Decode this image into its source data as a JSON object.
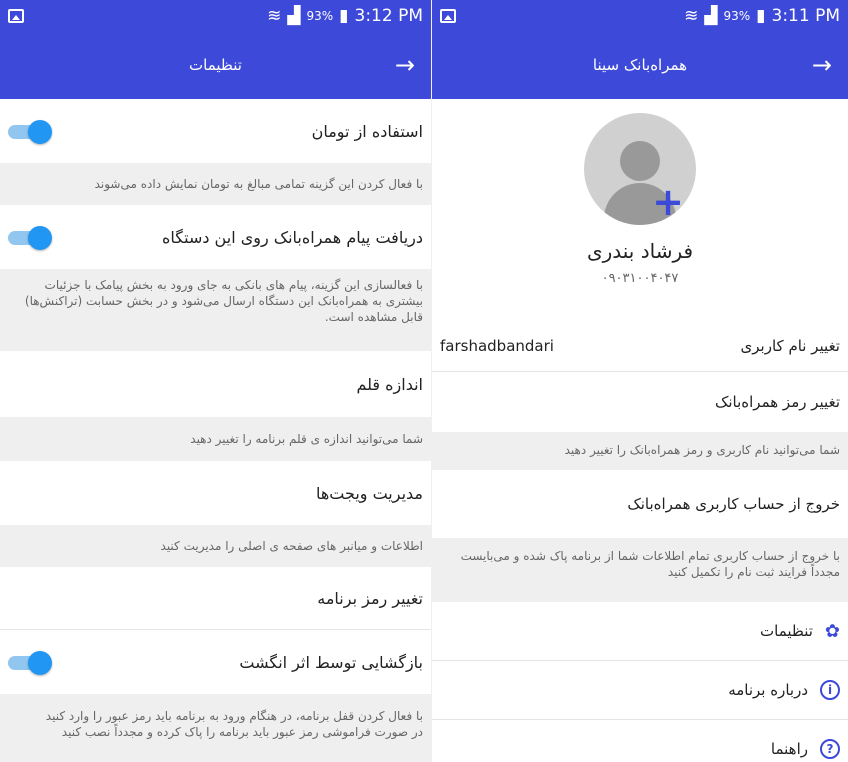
{
  "left": {
    "status": {
      "signal": "93%",
      "time": "3:12 PM"
    },
    "appbar": {
      "title": "تنظیمات",
      "back": "→"
    },
    "items": [
      {
        "title": "استفاده از تومان",
        "note": "با فعال کردن این گزینه تمامی مبالغ به تومان نمایش داده می‌شوند"
      },
      {
        "title": "دریافت پیام همراه‌بانک روی این دستگاه",
        "note": "با فعالسازی این گزینه، پیام های بانکی به جای ورود به بخش پیامک با جزئیات بیشتری به همراه‌بانک این دستگاه ارسال می‌شود و در بخش حسابت (تراکنش‌ها) قابل مشاهده است."
      },
      {
        "title": "اندازه قلم",
        "note": "شما می‌توانید اندازه ی قلم برنامه را تغییر دهید"
      },
      {
        "title": "مدیریت ویجت‌ها",
        "note": "اطلاعات و میانبر های صفحه ی اصلی را مدیریت کنید"
      },
      {
        "title": "تغییر رمز برنامه"
      },
      {
        "title": "بازگشایی توسط اثر انگشت",
        "note_line1": "با فعال کردن قفل برنامه، در هنگام ورود به برنامه باید رمز عبور را وارد کنید",
        "note_line2": "در صورت فراموشی رمز عبور باید برنامه را پاک کرده و مجدداً نصب کنید"
      }
    ]
  },
  "right": {
    "status": {
      "signal": "93%",
      "time": "3:11 PM"
    },
    "appbar": {
      "title": "همراه‌بانک سینا",
      "back": "→"
    },
    "profile": {
      "name": "فرشاد بندری",
      "number": "۰۹۰۳۱۰۰۴۰۴۷"
    },
    "username_row": {
      "label": "تغییر نام کاربری",
      "value": "farshadbandari"
    },
    "password_row": {
      "label": "تغییر رمز همراه‌بانک"
    },
    "note1": "شما می‌توانید نام کاربری و رمز همراه‌بانک را تغییر دهید",
    "logout_row": {
      "label": "خروج از حساب کاربری همراه‌بانک"
    },
    "note2": "با خروج از حساب کاربری تمام اطلاعات شما از برنامه پاک شده و می‌بایست مجدداً فرایند ثبت نام را تکمیل کنید",
    "menu": [
      {
        "label": "تنظیمات",
        "icon": "gear-icon"
      },
      {
        "label": "درباره برنامه",
        "icon": "info-icon"
      },
      {
        "label": "راهنما",
        "icon": "help-icon"
      }
    ]
  }
}
